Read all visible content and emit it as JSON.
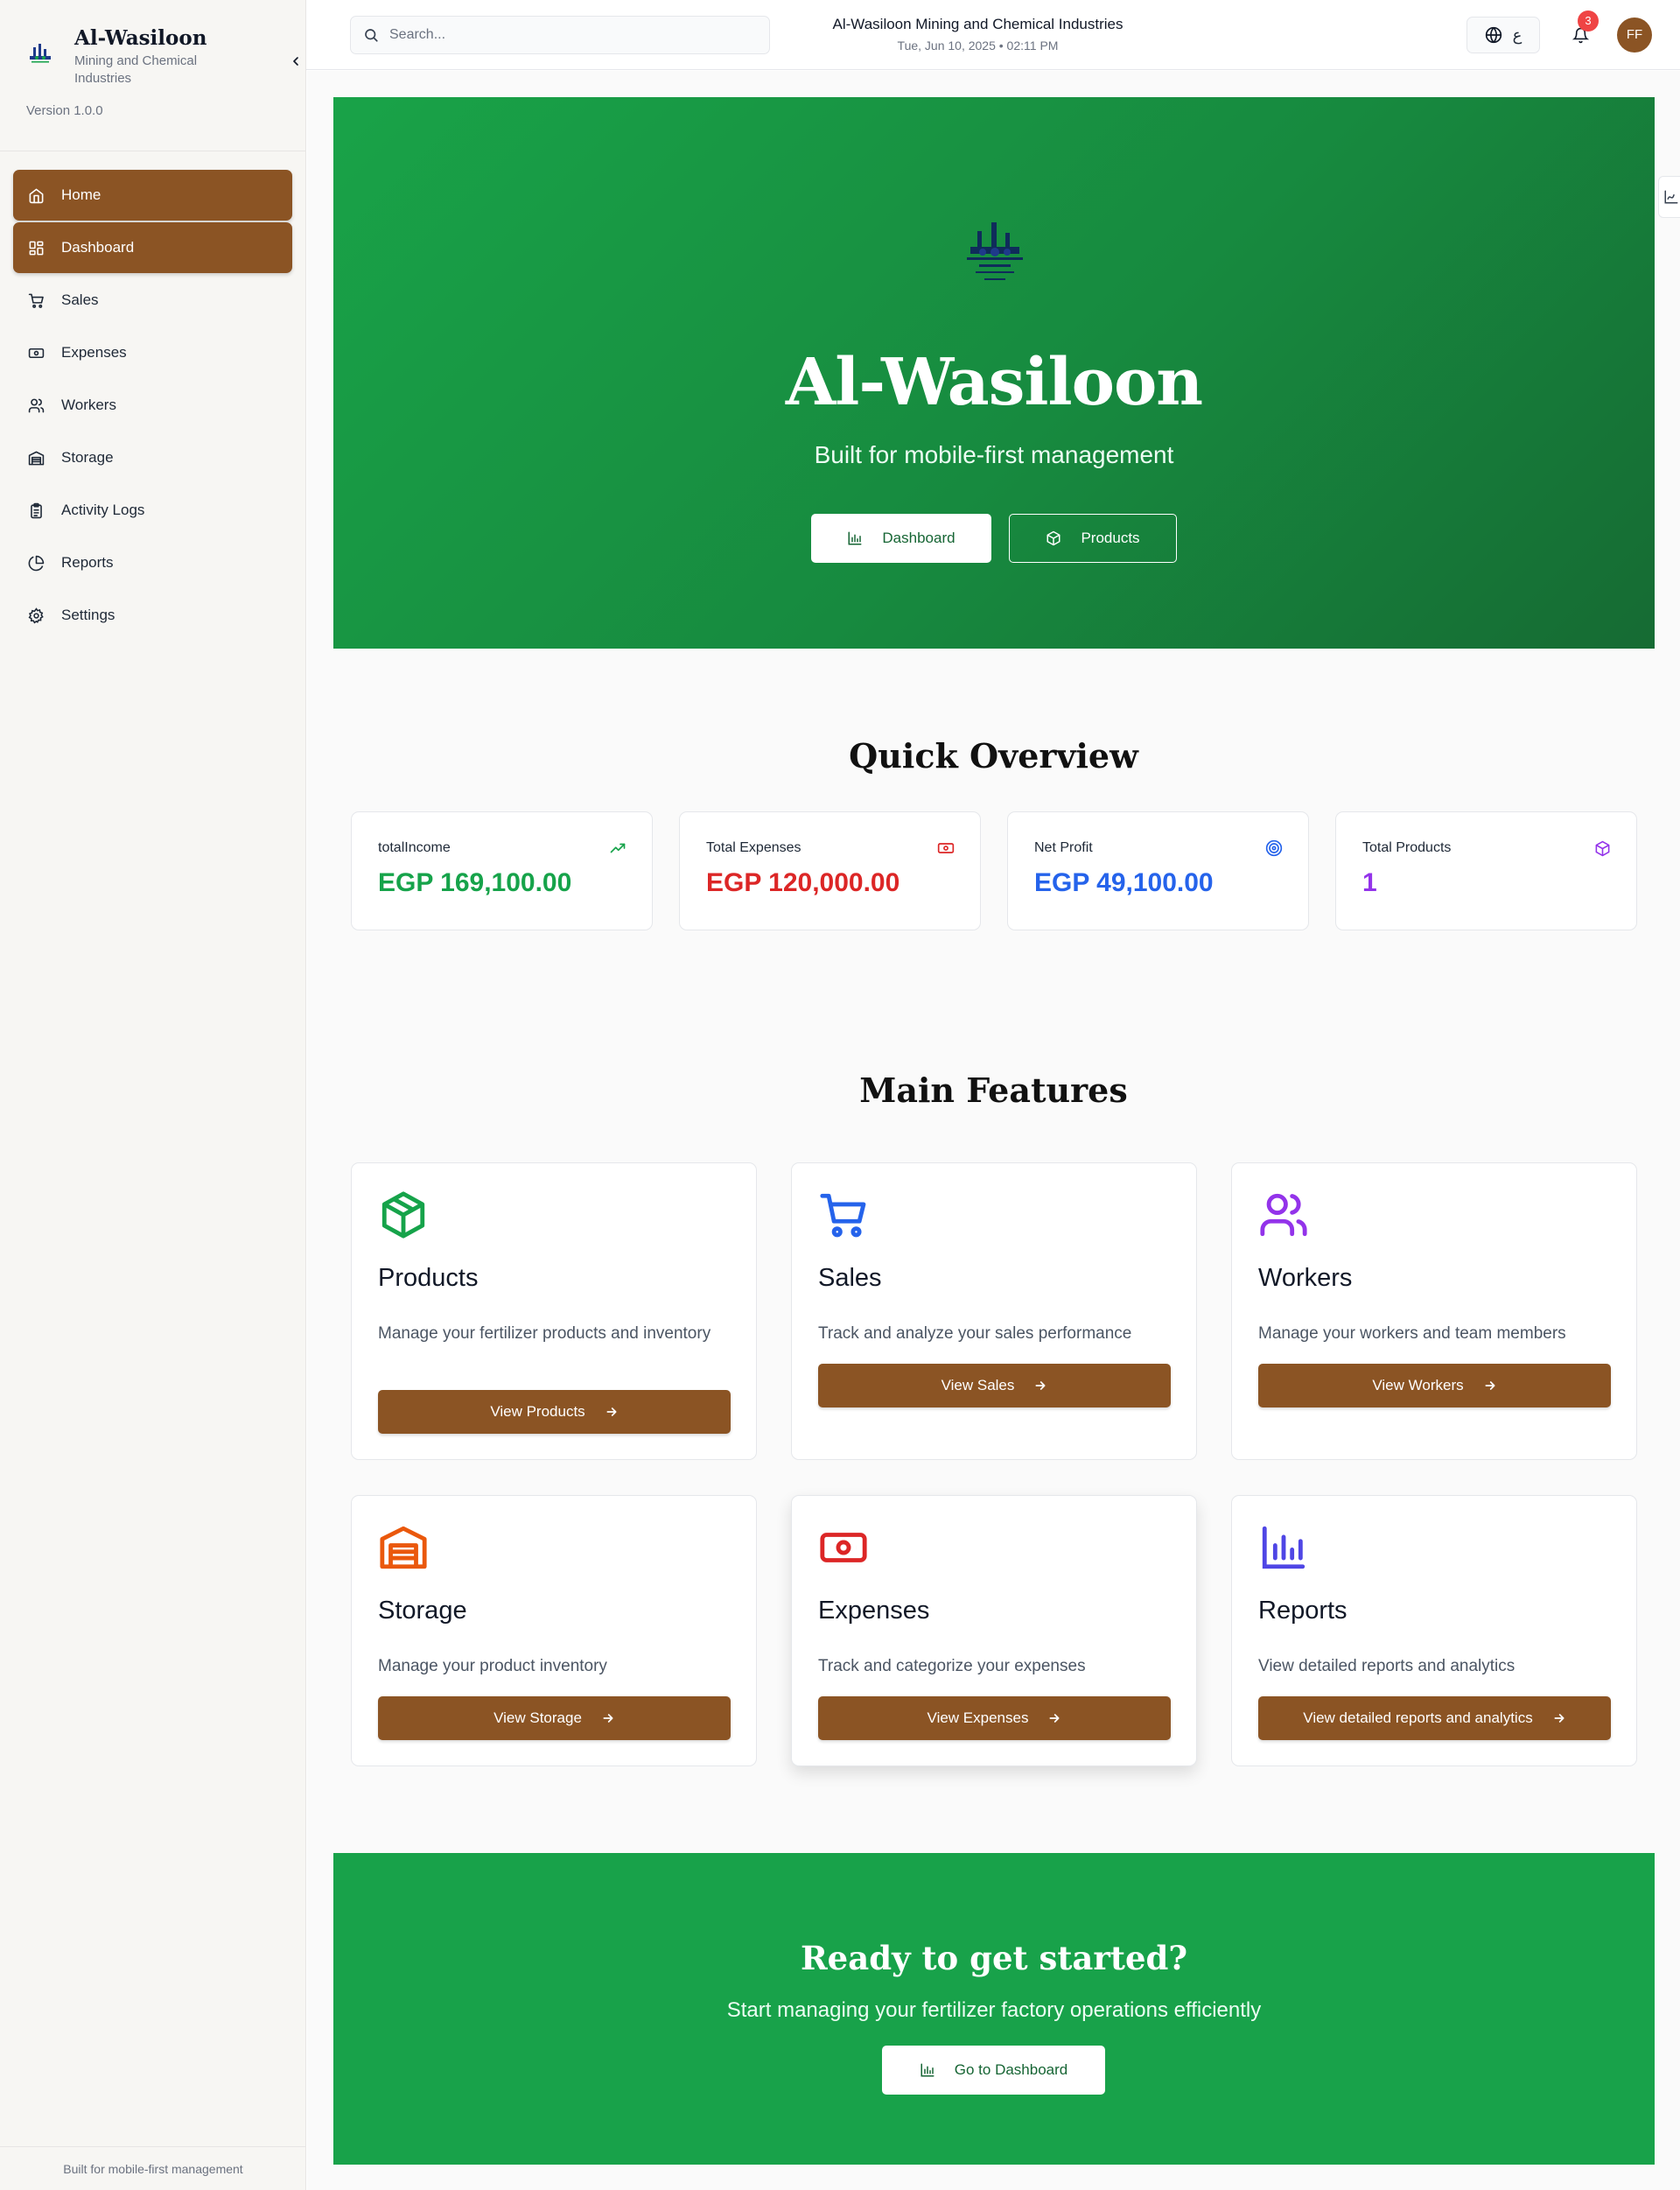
{
  "sidebar": {
    "brand_title": "Al-Wasiloon",
    "brand_subtitle": "Mining and Chemical Industries",
    "version": "Version 1.0.0",
    "items": [
      {
        "label": "Home",
        "icon": "home-icon"
      },
      {
        "label": "Dashboard",
        "icon": "dashboard-icon"
      },
      {
        "label": "Sales",
        "icon": "cart-icon"
      },
      {
        "label": "Expenses",
        "icon": "banknote-icon"
      },
      {
        "label": "Workers",
        "icon": "users-icon"
      },
      {
        "label": "Storage",
        "icon": "warehouse-icon"
      },
      {
        "label": "Activity Logs",
        "icon": "clipboard-icon"
      },
      {
        "label": "Reports",
        "icon": "pie-chart-icon"
      },
      {
        "label": "Settings",
        "icon": "gear-icon"
      }
    ],
    "footer": "Built for mobile-first management"
  },
  "header": {
    "search_placeholder": "Search...",
    "title": "Al-Wasiloon Mining and Chemical Industries",
    "datetime": "Tue, Jun 10, 2025 • 02:11 PM",
    "language": "ع",
    "notification_count": "3",
    "avatar_initials": "FF"
  },
  "hero": {
    "title": "Al-Wasiloon",
    "subtitle": "Built for mobile-first management",
    "dashboard_button": "Dashboard",
    "products_button": "Products"
  },
  "overview": {
    "title": "Quick Overview",
    "stats": [
      {
        "label": "totalIncome",
        "value": "EGP 169,100.00",
        "color": "#16a34a",
        "icon": "trending-up-icon"
      },
      {
        "label": "Total Expenses",
        "value": "EGP 120,000.00",
        "color": "#dc2626",
        "icon": "banknote-icon"
      },
      {
        "label": "Net Profit",
        "value": "EGP 49,100.00",
        "color": "#2563eb",
        "icon": "target-icon"
      },
      {
        "label": "Total Products",
        "value": "1",
        "color": "#9333ea",
        "icon": "package-icon"
      }
    ]
  },
  "features": {
    "title": "Main Features",
    "cards": [
      {
        "title": "Products",
        "description": "Manage your fertilizer products and inventory",
        "button": "View Products",
        "icon": "package-icon",
        "color": "#16a34a"
      },
      {
        "title": "Sales",
        "description": "Track and analyze your sales performance",
        "button": "View Sales",
        "icon": "cart-icon",
        "color": "#2563eb"
      },
      {
        "title": "Workers",
        "description": "Manage your workers and team members",
        "button": "View Workers",
        "icon": "users-icon",
        "color": "#9333ea"
      },
      {
        "title": "Storage",
        "description": "Manage your product inventory",
        "button": "View Storage",
        "icon": "warehouse-icon",
        "color": "#ea580c"
      },
      {
        "title": "Expenses",
        "description": "Track and categorize your expenses",
        "button": "View Expenses",
        "icon": "banknote-icon",
        "color": "#dc2626"
      },
      {
        "title": "Reports",
        "description": "View detailed reports and analytics",
        "button": "View detailed reports and analytics",
        "icon": "bar-chart-icon",
        "color": "#4f46e5"
      }
    ]
  },
  "cta": {
    "title": "Ready to get started?",
    "subtitle": "Start managing your fertilizer factory operations efficiently",
    "button": "Go to Dashboard"
  },
  "colors": {
    "brand_brown": "#8b5424",
    "hero_green": "#19a348",
    "cta_green": "#18a24a"
  }
}
